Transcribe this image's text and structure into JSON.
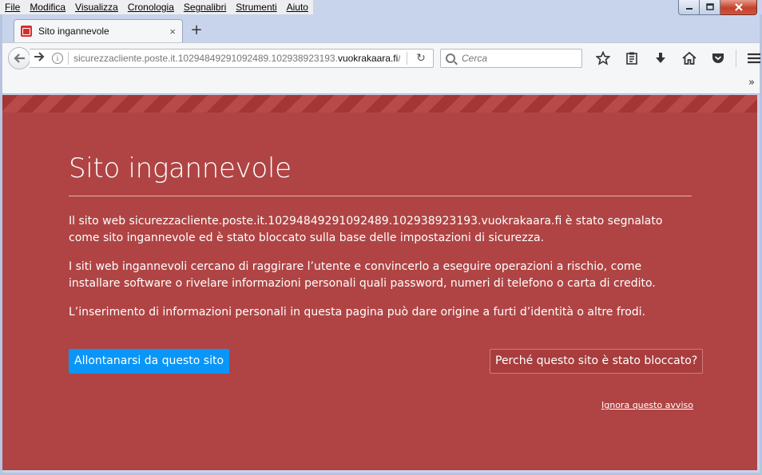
{
  "menu": [
    "File",
    "Modifica",
    "Visualizza",
    "Cronologia",
    "Segnalibri",
    "Strumenti",
    "Aiuto"
  ],
  "tab": {
    "title": "Sito ingannevole",
    "close": "×",
    "new_tab": "+"
  },
  "url": {
    "prefix": "sicurezzacliente.poste.it.10294849291092489.102938923193.",
    "domain": "vuokrakaara.fi",
    "suffix": "/"
  },
  "search": {
    "placeholder": "Cerca"
  },
  "icons": {
    "back": "back-arrow-icon",
    "forward": "forward-arrow-icon",
    "info": "info-icon",
    "reload": "reload-icon",
    "bookmark": "star-icon",
    "reading_list": "reading-list-icon",
    "download": "download-icon",
    "home": "home-icon",
    "pocket": "pocket-icon",
    "menu": "hamburger-menu-icon"
  },
  "main": {
    "title": "Sito ingannevole",
    "paragraph1": "Il sito web sicurezzacliente.poste.it.10294849291092489.102938923193.vuokrakaara.fi è stato segnalato come sito ingannevole ed è stato bloccato sulla base delle impostazioni di sicurezza.",
    "paragraph2": "I siti web ingannevoli cercano di raggirare l’utente e convincerlo a eseguire operazioni a rischio, come installare software o rivelare informazioni personali quali password, numeri di telefono o carta di credito.",
    "paragraph3": "L’inserimento di informazioni personali in questa pagina può dare origine a furti d’identità o altre frodi.",
    "leave_button": "Allontanarsi da questo sito",
    "why_button": "Perché questo sito è stato bloccato?",
    "ignore_link": "Ignora questo avviso"
  },
  "colors": {
    "background": "#b04444",
    "primary_button": "#0996f8"
  }
}
